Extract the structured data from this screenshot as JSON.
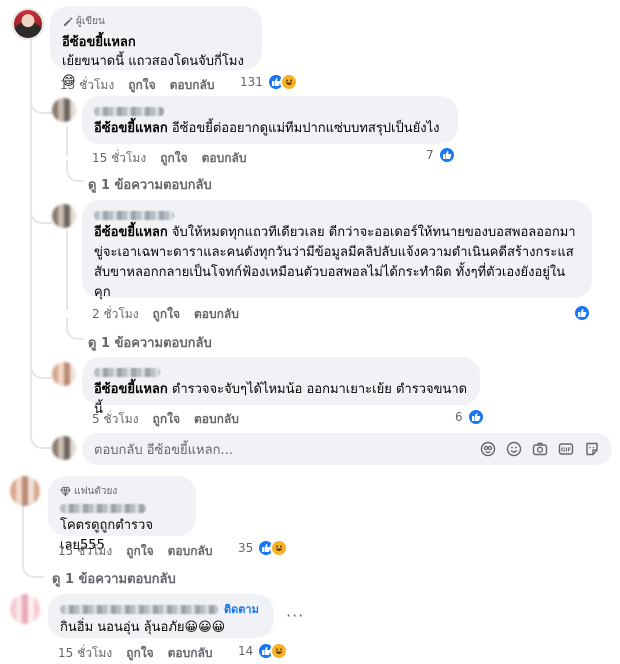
{
  "comments": [
    {
      "badge": "ผู้เขียน",
      "name": "อีซ้อขยี้แหลก",
      "text": "เย้ยขนาดนี้ แถวสองโดนจับกี่โมง😄",
      "time": "15 ชั่วโมง",
      "like": "ถูกใจ",
      "reply": "ตอบกลับ",
      "reactions": "131",
      "icons": [
        "like-icon",
        "haha-icon"
      ]
    },
    {
      "name": "อีซ้อขยี้แหลก",
      "text": "อีซ้อขยี้ต่ออยากดูแม่ทีมปากแซ่บบทสรุปเป็นยังไง",
      "time": "15 ชั่วโมง",
      "like": "ถูกใจ",
      "reply": "ตอบกลับ",
      "reactions": "7",
      "view_replies": "ดู 1 ข้อความตอบกลับ"
    },
    {
      "name": "อีซ้อขยี้แหลก",
      "text": "จับให้หมดทุกแถวทีเดียวเลย ดีกว่าจะออเดอร์ให้ทนายของบอสพอลออกมาขู่จะเอาเฉพาะดาราและคนดังทุกวันว่ามีข้อมูลมีคลิปลับแจ้งความดำเนินคดีสร้างกระแสสับขาหลอกกลายเป็นโจทก์ฟ้องเหมือนตัวบอสพอลไม่ได้กระทำผิด ทั้งๆที่ตัวเองยังอยู่ในคุก",
      "time": "2 ชั่วโมง",
      "like": "ถูกใจ",
      "reply": "ตอบกลับ",
      "view_replies": "ดู 1 ข้อความตอบกลับ"
    },
    {
      "name": "อีซ้อขยี้แหลก",
      "text": "ตำรวจจะจับๆได้ไหมน้อ ออกมาเยาะเย้ย ตำรวจขนาดนี้",
      "time": "5 ชั่วโมง",
      "like": "ถูกใจ",
      "reply": "ตอบกลับ",
      "reactions": "6"
    },
    {
      "badge": "แฟนตัวยง",
      "text": "โคตรดูถูกตำรวจเลย555",
      "time": "15 ชั่วโมง",
      "like": "ถูกใจ",
      "reply": "ตอบกลับ",
      "reactions": "35",
      "view_replies": "ดู 1 ข้อความตอบกลับ"
    },
    {
      "follow": "ติดตาม",
      "text": "กินอิ่ม นอนอุ่น ลุ้นอภัย😀😀😀",
      "time": "15 ชั่วโมง",
      "like": "ถูกใจ",
      "reply": "ตอบกลับ",
      "reactions": "14"
    }
  ],
  "reply_box": {
    "placeholder": "ตอบกลับ อีซ้อขยี้แหลก...",
    "icons": [
      "avatar-sticker-icon",
      "emoji-icon",
      "camera-icon",
      "gif-icon",
      "sticker-icon"
    ]
  },
  "colors": {
    "accent": "#1877f2",
    "bubble": "#f0f2f5",
    "muted": "#65676b"
  }
}
